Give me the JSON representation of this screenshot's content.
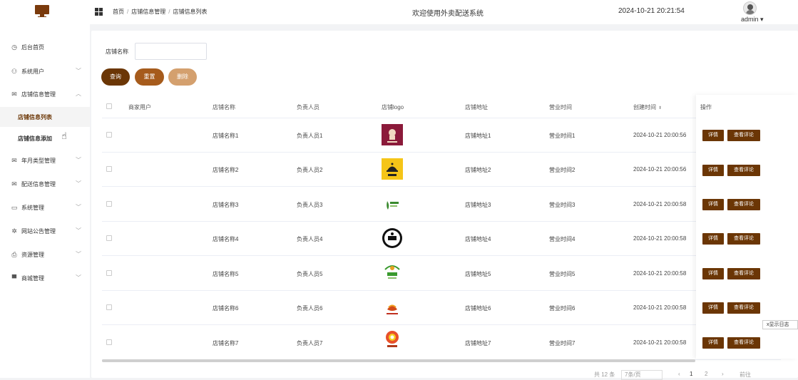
{
  "header": {
    "breadcrumb": [
      "首页",
      "店铺信息管理",
      "店铺信息列表"
    ],
    "welcome": "欢迎使用外卖配送系统",
    "datetime": "2024-10-21 20:21:54",
    "user": "admin"
  },
  "sidebar": {
    "items": [
      {
        "label": "后台首页",
        "icon": "clock-icon"
      },
      {
        "label": "系统用户",
        "icon": "user-icon"
      },
      {
        "label": "店铺信息管理",
        "icon": "mail-icon"
      },
      {
        "label": "年月类型管理",
        "icon": "mail-icon"
      },
      {
        "label": "配送信息管理",
        "icon": "mail-icon"
      },
      {
        "label": "系统管理",
        "icon": "folder-icon"
      },
      {
        "label": "网站公告管理",
        "icon": "sun-icon"
      },
      {
        "label": "资源管理",
        "icon": "printer-icon"
      },
      {
        "label": "商城管理",
        "icon": "monitor-icon"
      }
    ],
    "subitems": [
      {
        "label": "店铺信息列表"
      },
      {
        "label": "店铺信息添加"
      }
    ]
  },
  "filter": {
    "label": "店铺名称",
    "value": "",
    "query_label": "查询",
    "reset_label": "重置",
    "delete_label": "删除"
  },
  "table": {
    "columns": [
      "商家用户",
      "店铺名称",
      "负责人员",
      "店铺logo",
      "店铺地址",
      "营业时间",
      "创建时间",
      "操作"
    ],
    "rows": [
      {
        "user": "",
        "name": "店铺名称1",
        "manager": "负责人员1",
        "address": "店铺地址1",
        "hours": "营业时间1",
        "created": "2024-10-21 20:00:56"
      },
      {
        "user": "",
        "name": "店铺名称2",
        "manager": "负责人员2",
        "address": "店铺地址2",
        "hours": "营业时间2",
        "created": "2024-10-21 20:00:56"
      },
      {
        "user": "",
        "name": "店铺名称3",
        "manager": "负责人员3",
        "address": "店铺地址3",
        "hours": "营业时间3",
        "created": "2024-10-21 20:00:58"
      },
      {
        "user": "",
        "name": "店铺名称4",
        "manager": "负责人员4",
        "address": "店铺地址4",
        "hours": "营业时间4",
        "created": "2024-10-21 20:00:58"
      },
      {
        "user": "",
        "name": "店铺名称5",
        "manager": "负责人员5",
        "address": "店铺地址5",
        "hours": "营业时间5",
        "created": "2024-10-21 20:00:58"
      },
      {
        "user": "",
        "name": "店铺名称6",
        "manager": "负责人员6",
        "address": "店铺地址6",
        "hours": "营业时间6",
        "created": "2024-10-21 20:00:58"
      },
      {
        "user": "",
        "name": "店铺名称7",
        "manager": "负责人员7",
        "address": "店铺地址7",
        "hours": "营业时间7",
        "created": "2024-10-21 20:00:58"
      }
    ],
    "detail_label": "详情",
    "review_label": "查看评论"
  },
  "float_tag": "x显示日志",
  "pagination": {
    "total": "共 12 条",
    "page_size": "7条/页",
    "page1": "1",
    "page2": "2",
    "goto": "前往"
  },
  "colors": {
    "primary": "#6b3605",
    "reset": "#a65b1c",
    "delete": "#d4a06e"
  }
}
